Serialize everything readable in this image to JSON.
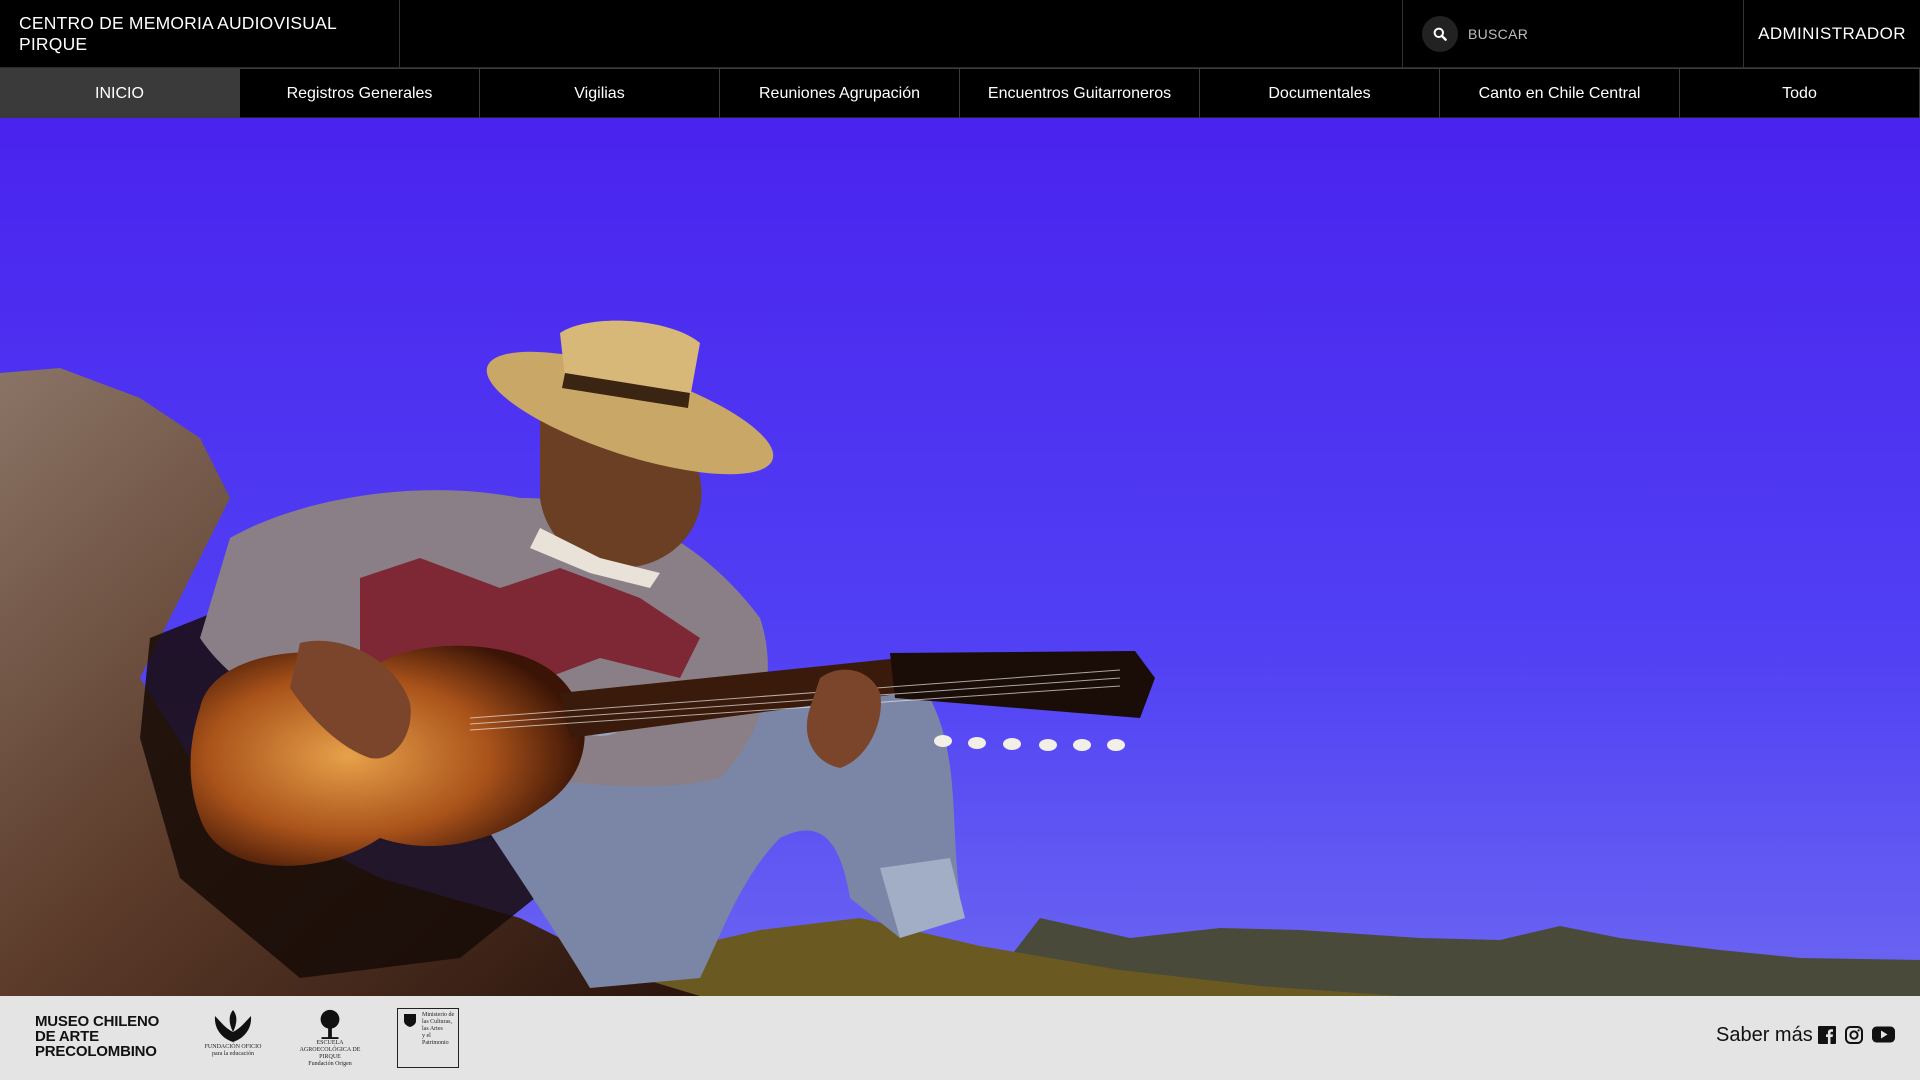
{
  "header": {
    "site_title": "CENTRO DE MEMORIA AUDIOVISUAL PIRQUE",
    "search_placeholder": "BUSCAR",
    "admin_label": "ADMINISTRADOR",
    "search_icon": "search-icon"
  },
  "nav": {
    "items": [
      {
        "label": "INICIO",
        "active": true
      },
      {
        "label": "Registros Generales"
      },
      {
        "label": "Vigilias"
      },
      {
        "label": "Reuniones Agrupación"
      },
      {
        "label": "Encuentros Guitarroneros"
      },
      {
        "label": "Documentales"
      },
      {
        "label": "Canto en Chile Central"
      },
      {
        "label": "Todo"
      }
    ]
  },
  "footer": {
    "museo_logo_lines": [
      "MUSEO CHILENO",
      "DE ARTE",
      "PRECOLOMBINO"
    ],
    "fundacion_caption": [
      "FUNDACIÓN OFICIO",
      "para la educación"
    ],
    "escuela_caption": [
      "ESCUELA",
      "AGROECOLÓGICA DE PIRQUE",
      "Fundación Origen"
    ],
    "ministerio_caption": [
      "Ministerio de",
      "las Culturas,",
      "las Artes",
      "y el Patrimonio"
    ],
    "saber_mas": "Saber más",
    "social_icons": [
      "facebook-icon",
      "instagram-icon",
      "youtube-icon"
    ]
  },
  "colors": {
    "header_bg": "#000000",
    "nav_active_bg": "#3a3a3a",
    "sky": "#4b34ef",
    "footer_bg": "#e4e4e4"
  }
}
